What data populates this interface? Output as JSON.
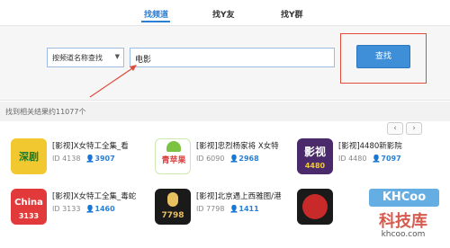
{
  "tabs": [
    {
      "label": "找频道",
      "active": true
    },
    {
      "label": "找Y友",
      "active": false
    },
    {
      "label": "找Y群",
      "active": false
    }
  ],
  "search": {
    "mode_select": "按频道名称查找",
    "query": "电影",
    "button": "查找"
  },
  "results": {
    "count_text": "找到相关结果约11077个",
    "prev": "‹",
    "next": "›",
    "items": [
      {
        "title": "[影视]X女特工全集_看",
        "id": "ID 4138",
        "users": "3907",
        "thumb_text": "深剧",
        "thumb_color": "#f2c830"
      },
      {
        "title": "[影视]忠烈杨家将 X女特",
        "id": "ID 6090",
        "users": "2968",
        "thumb_text": "青苹果",
        "thumb_color": "#7cc243"
      },
      {
        "title": "[影视]4480新影院",
        "id": "ID 4480",
        "users": "7097",
        "thumb_text": "影视",
        "thumb_color": "#4a2a6a"
      },
      {
        "title": "[影视]X女特工全集_毒蛇",
        "id": "ID 3133",
        "users": "1460",
        "thumb_text": "China",
        "thumb_color": "#e23a3a"
      },
      {
        "title": "[影视]北京遇上西雅图/港",
        "id": "ID 7798",
        "users": "1411",
        "thumb_text": "7798",
        "thumb_color": "#1a1a1a"
      },
      {
        "title": "",
        "id": "",
        "users": "",
        "thumb_text": "",
        "thumb_color": "#c82a2a"
      }
    ]
  },
  "watermark": {
    "brand": "KHCoo",
    "name": "科技库",
    "url": "khcoo.com"
  },
  "colors": {
    "accent": "#2a7fd6",
    "annotation": "#e04b3a"
  }
}
